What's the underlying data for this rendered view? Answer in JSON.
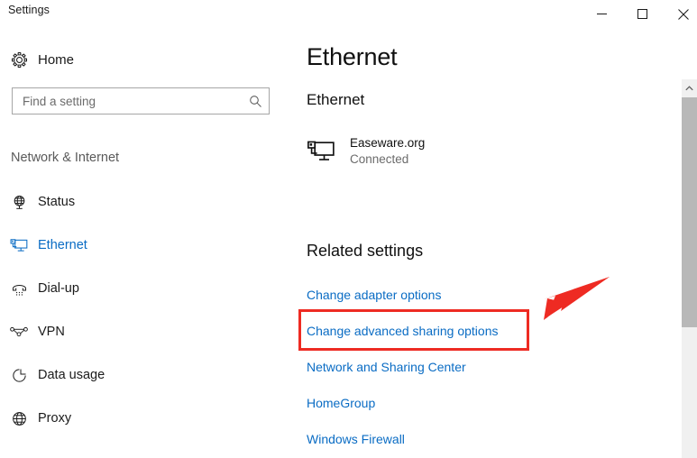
{
  "window": {
    "title": "Settings",
    "controls": [
      {
        "name": "minimize",
        "glyph": "minimize-icon"
      },
      {
        "name": "maximize",
        "glyph": "maximize-icon"
      },
      {
        "name": "close",
        "glyph": "close-icon"
      }
    ]
  },
  "sidebar": {
    "home": {
      "label": "Home",
      "icon": "gear-icon"
    },
    "search": {
      "value": "",
      "placeholder": "Find a setting",
      "icon": "search-icon"
    },
    "category": "Network & Internet",
    "items": [
      {
        "label": "Status",
        "icon": "globe-stand-icon",
        "selected": false
      },
      {
        "label": "Ethernet",
        "icon": "ethernet-monitor-icon",
        "selected": true
      },
      {
        "label": "Dial-up",
        "icon": "phone-handset-icon",
        "selected": false
      },
      {
        "label": "VPN",
        "icon": "vpn-icon",
        "selected": false
      },
      {
        "label": "Data usage",
        "icon": "pie-chart-icon",
        "selected": false
      },
      {
        "label": "Proxy",
        "icon": "globe-icon",
        "selected": false
      }
    ]
  },
  "main": {
    "page_title": "Ethernet",
    "section_title": "Ethernet",
    "connection": {
      "icon": "ethernet-monitor-icon",
      "name": "Easeware.org",
      "status": "Connected"
    },
    "related": {
      "heading": "Related settings",
      "links": [
        "Change adapter options",
        "Change advanced sharing options",
        "Network and Sharing Center",
        "HomeGroup",
        "Windows Firewall"
      ]
    }
  },
  "scrollbar": {
    "up_arrow": "chevron-up-icon"
  },
  "annotations": {
    "highlight_target": "Network and Sharing Center",
    "arrow": "red-arrow-pointing-down-left"
  },
  "colors": {
    "link_blue": "#0a6cc4",
    "accent_blue": "#0a6cc4",
    "annotation_red": "#ee2b23",
    "muted_text": "#6b6b6b",
    "window_bg": "#ffffff"
  }
}
